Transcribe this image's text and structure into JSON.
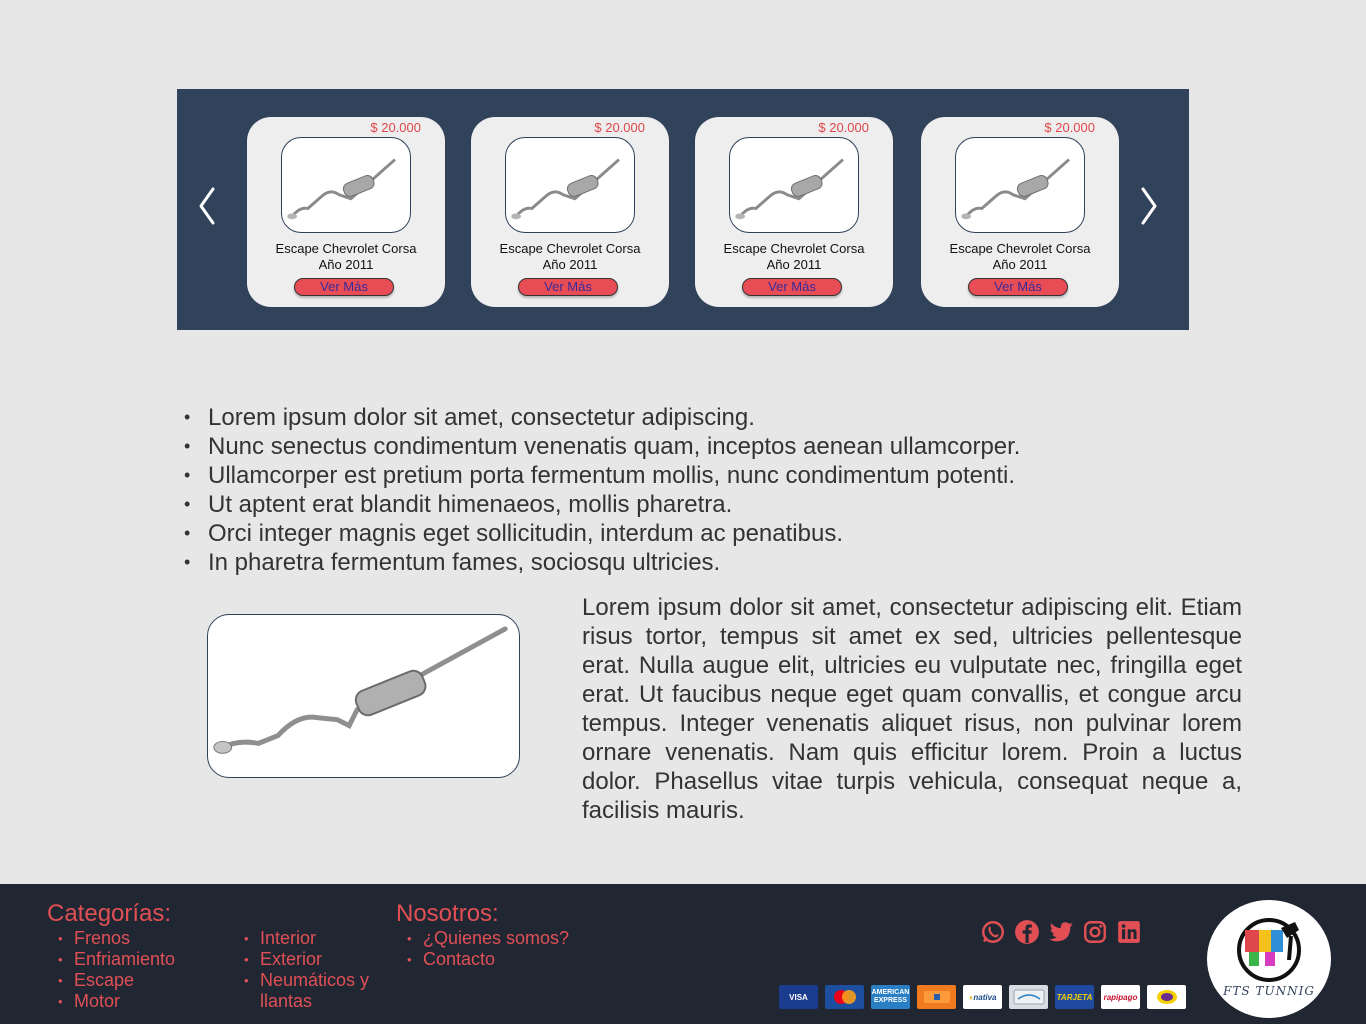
{
  "carousel": {
    "prev_icon": "chevron-left-icon",
    "next_icon": "chevron-right-icon",
    "cards": [
      {
        "price": "$ 20.000",
        "name_line1": "Escape Chevrolet Corsa",
        "name_line2": "Año 2011",
        "button": "Ver Más"
      },
      {
        "price": "$ 20.000",
        "name_line1": "Escape Chevrolet Corsa",
        "name_line2": "Año 2011",
        "button": "Ver Más"
      },
      {
        "price": "$ 20.000",
        "name_line1": "Escape Chevrolet Corsa",
        "name_line2": "Año 2011",
        "button": "Ver Más"
      },
      {
        "price": "$ 20.000",
        "name_line1": "Escape Chevrolet Corsa",
        "name_line2": "Año 2011",
        "button": "Ver Más"
      }
    ]
  },
  "bullets": [
    "Lorem ipsum dolor sit amet, consectetur adipiscing.",
    "Nunc senectus condimentum venenatis quam, inceptos aenean ullamcorper.",
    "Ullamcorper est pretium porta fermentum mollis, nunc condimentum potenti.",
    "Ut aptent erat blandit himenaeos, mollis pharetra.",
    "Orci integer magnis eget sollicitudin, interdum ac penatibus.",
    "In pharetra fermentum fames, sociosqu ultricies."
  ],
  "paragraph": "Lorem ipsum dolor sit amet, consectetur adipiscing elit. Etiam risus tortor, tempus sit amet ex sed, ultricies pellentesque erat. Nulla augue elit, ultricies eu vulputate nec, fringilla eget erat. Ut faucibus neque eget quam convallis, et congue arcu tempus. Integer venenatis aliquet risus, non pulvinar lorem ornare venenatis. Nam quis efficitur lorem. Proin a luctus dolor. Phasellus vitae turpis vehicula, consequat neque a, facilisis mauris.",
  "footer": {
    "categories_title": "Categorías:",
    "categories_col1": [
      "Frenos",
      "Enfriamiento",
      "Escape",
      "Motor"
    ],
    "categories_col2": [
      "Interior",
      "Exterior",
      "Neumáticos y llantas"
    ],
    "about_title": "Nosotros:",
    "about_links": [
      "¿Quienes somos?",
      "Contacto"
    ],
    "social_icons": [
      "whatsapp-icon",
      "facebook-icon",
      "twitter-icon",
      "instagram-icon",
      "linkedin-icon"
    ],
    "payments": [
      {
        "label": "VISA",
        "bg": "#1a3c8f",
        "fg": "#ffffff"
      },
      {
        "label": "MC",
        "bg": "#1d4fa0",
        "fg": "#ffcc00"
      },
      {
        "label": "AMEX",
        "bg": "#2a7fc4",
        "fg": "#ffffff"
      },
      {
        "label": "",
        "bg": "#f07a1e",
        "fg": "#ffffff"
      },
      {
        "label": "nativa",
        "bg": "#ffffff",
        "fg": "#1a4a8a"
      },
      {
        "label": "",
        "bg": "#d8dde3",
        "fg": "#555555"
      },
      {
        "label": "TARJETA",
        "bg": "#1f4aa0",
        "fg": "#f4d000"
      },
      {
        "label": "rapipago",
        "bg": "#ffffff",
        "fg": "#c8102e"
      },
      {
        "label": "",
        "bg": "#ffffff",
        "fg": "#6a2c91"
      }
    ],
    "logo_text": "FTS TUNNIG"
  },
  "colors": {
    "carousel_bg": "#30435b",
    "accent_red": "#e14f55",
    "footer_bg": "#202733",
    "page_bg": "#e7e7e7"
  }
}
